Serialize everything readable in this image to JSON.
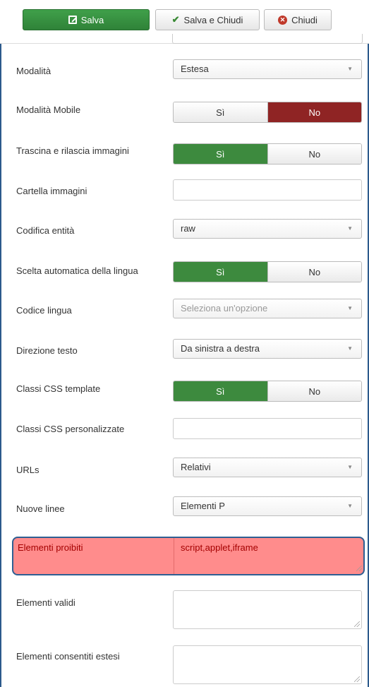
{
  "toolbar": {
    "save_label": "Salva",
    "save_close_label": "Salva e Chiudi",
    "close_label": "Chiudi"
  },
  "fields": {
    "modalita": {
      "label": "Modalità",
      "value": "Estesa"
    },
    "modalita_mobile": {
      "label": "Modalità Mobile",
      "yes": "Sì",
      "no": "No",
      "selected": "No"
    },
    "trascina": {
      "label": "Trascina e rilascia immagini",
      "yes": "Sì",
      "no": "No",
      "selected": "Sì"
    },
    "cartella": {
      "label": "Cartella immagini",
      "value": ""
    },
    "codifica": {
      "label": "Codifica entità",
      "value": "raw"
    },
    "scelta_lingua": {
      "label": "Scelta automatica della lingua",
      "yes": "Sì",
      "no": "No",
      "selected": "Sì"
    },
    "codice_lingua": {
      "label": "Codice lingua",
      "placeholder": "Seleziona un'opzione"
    },
    "direzione": {
      "label": "Direzione testo",
      "value": "Da sinistra a destra"
    },
    "classi_template": {
      "label": "Classi CSS template",
      "yes": "Sì",
      "no": "No",
      "selected": "Sì"
    },
    "classi_personalizzate": {
      "label": "Classi CSS personalizzate",
      "value": ""
    },
    "urls": {
      "label": "URLs",
      "value": "Relativi"
    },
    "nuove_linee": {
      "label": "Nuove linee",
      "value": "Elementi P"
    },
    "elementi_proibiti": {
      "label": "Elementi proibiti",
      "value": "script,applet,iframe"
    },
    "elementi_validi": {
      "label": "Elementi validi",
      "value": ""
    },
    "elementi_estesi": {
      "label": "Elementi consentiti estesi",
      "value": ""
    }
  },
  "colors": {
    "save_green": "#3a963f",
    "toggle_green": "#3d8a3e",
    "toggle_red": "#8f2424",
    "highlight_bg": "#ff8c8c",
    "highlight_border": "#2e5f93"
  }
}
